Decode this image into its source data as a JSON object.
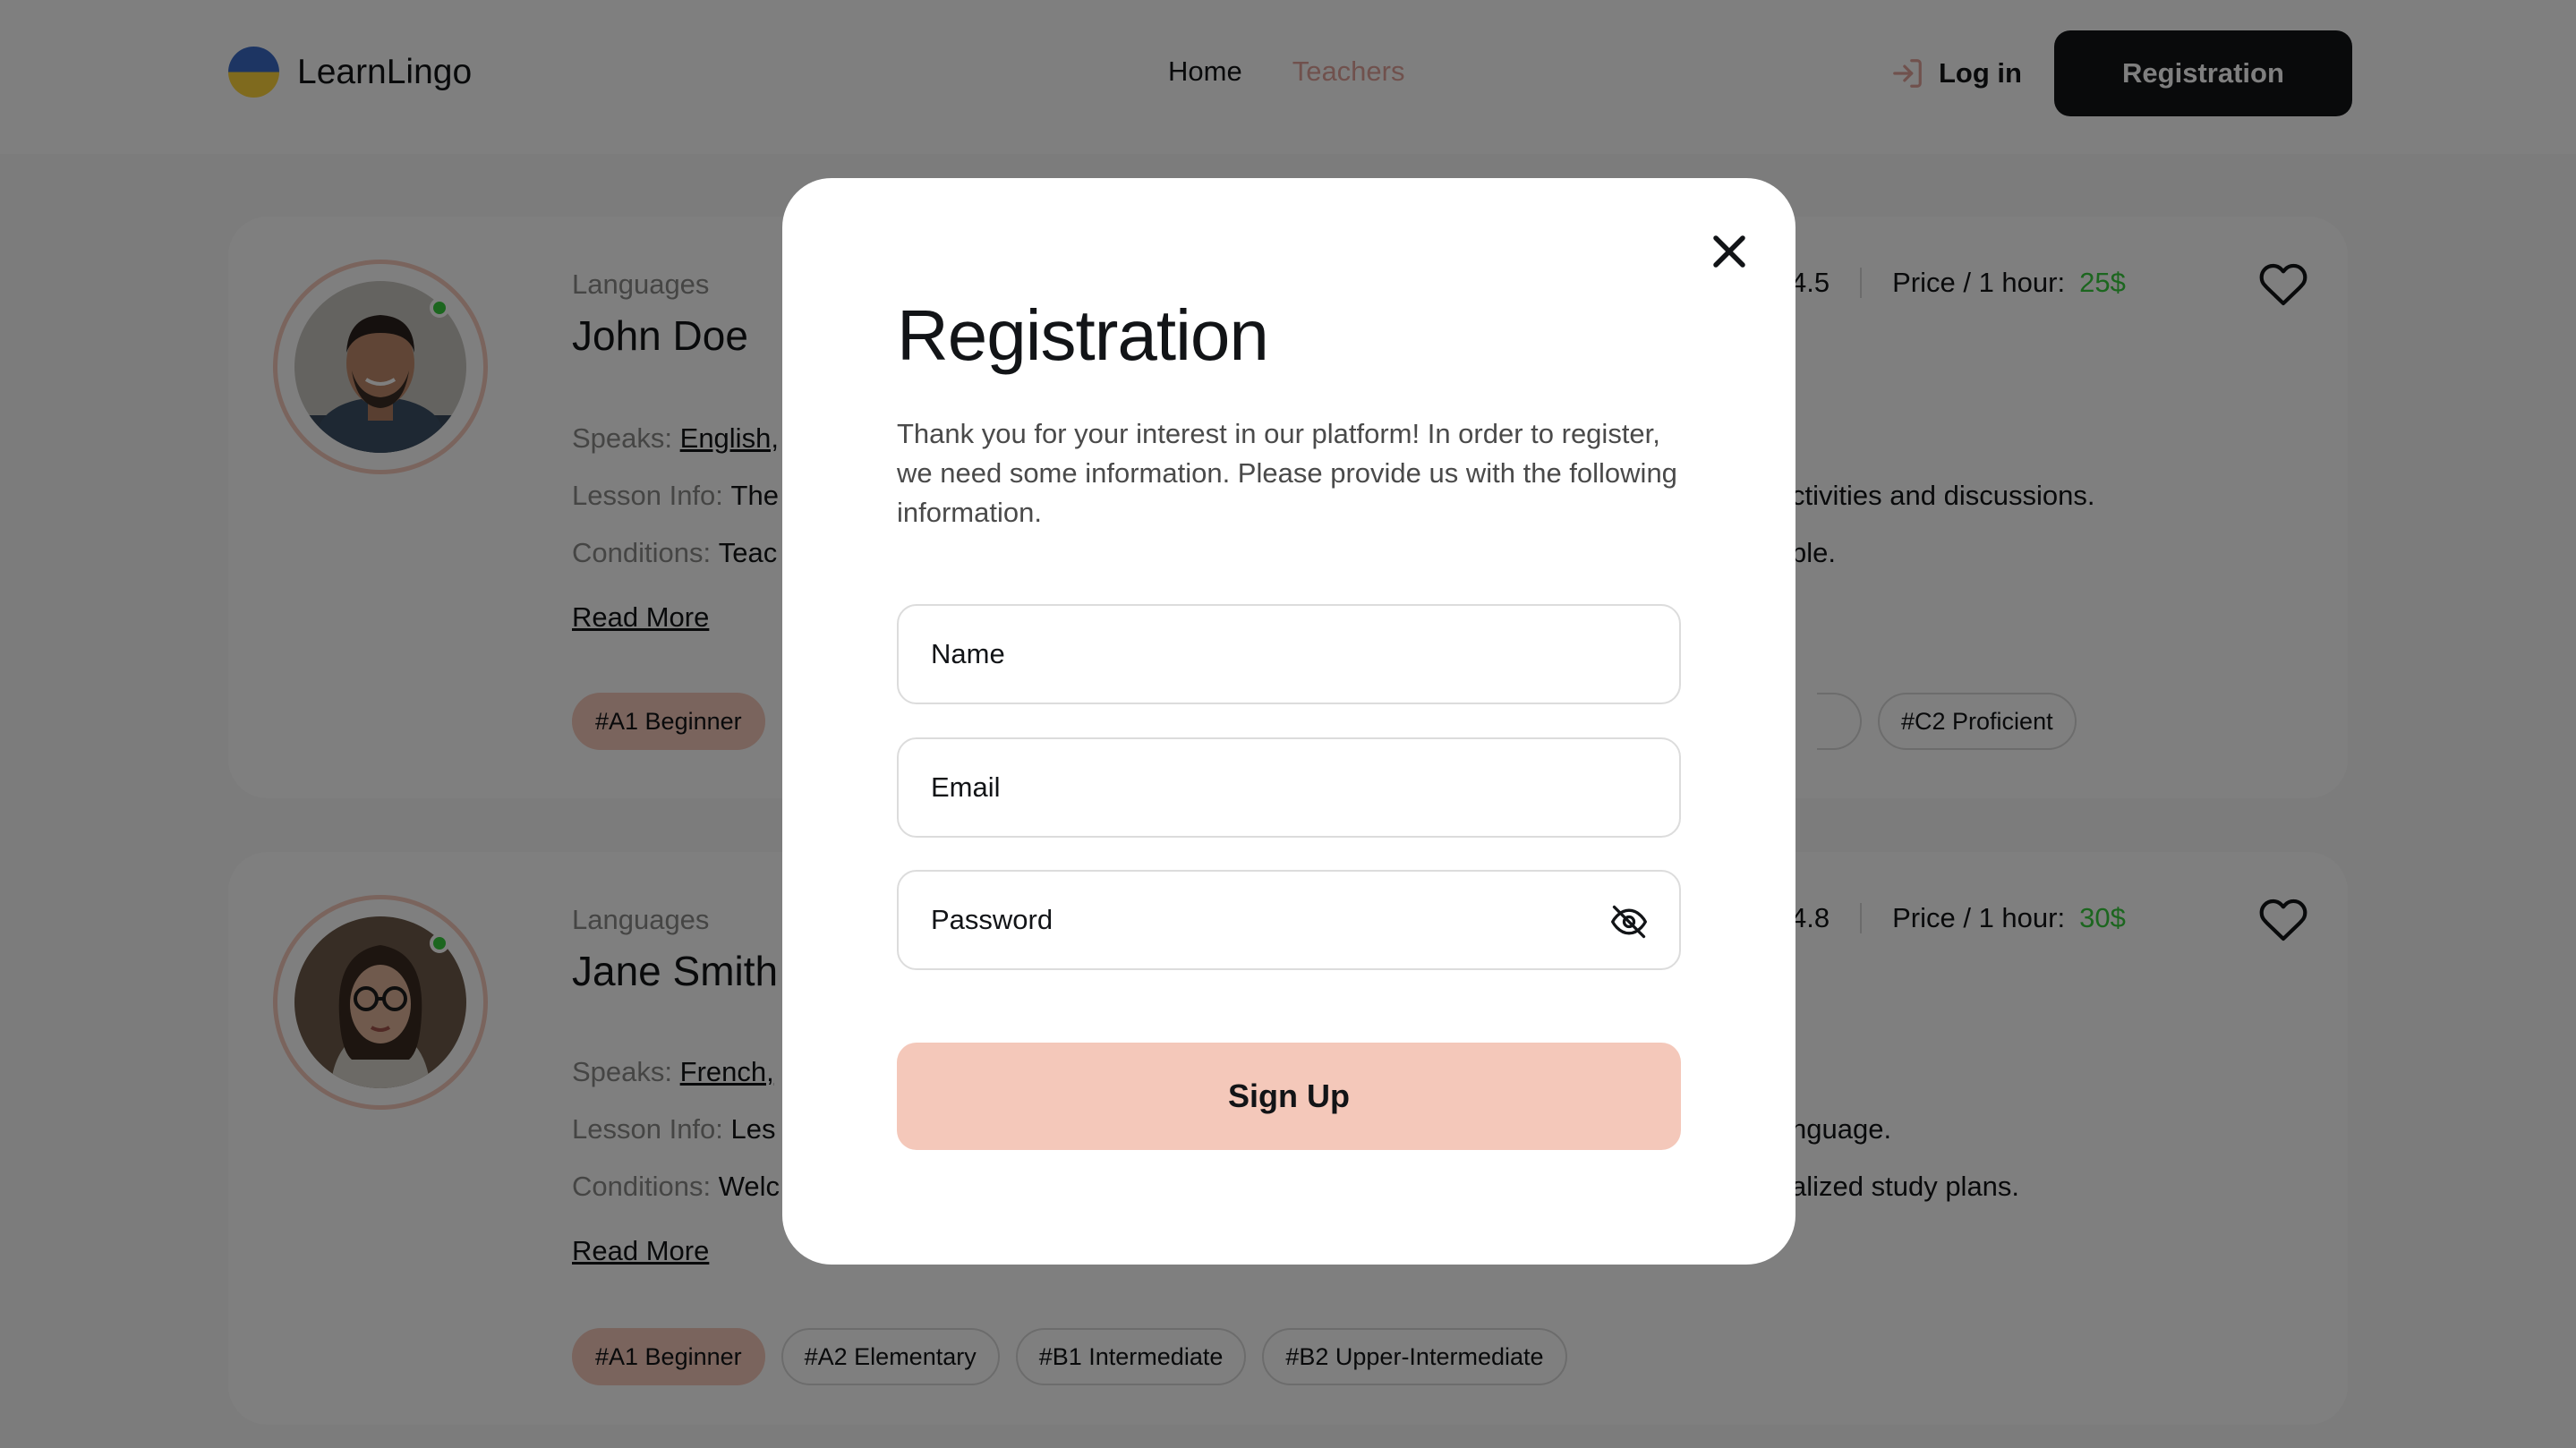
{
  "header": {
    "logo_text": "LearnLingo",
    "nav": [
      {
        "label": "Home",
        "active": false
      },
      {
        "label": "Teachers",
        "active": true
      }
    ],
    "login_label": "Log in",
    "registration_label": "Registration"
  },
  "teachers": [
    {
      "languages_label": "Languages",
      "name": "John Doe",
      "rating": "4.5",
      "price_label": "Price / 1 hour:",
      "price": "25$",
      "speaks_label": "Speaks:",
      "speaks_value": "English,",
      "lesson_label": "Lesson Info:",
      "lesson_value": "The",
      "lesson_tail": "ctivities and discussions.",
      "conditions_label": "Conditions:",
      "conditions_value": "Teac",
      "conditions_tail": "ble.",
      "read_more": "Read More",
      "levels": [
        "#A1 Beginner",
        "#C2 Proficient"
      ]
    },
    {
      "languages_label": "Languages",
      "name": "Jane Smith",
      "rating": "4.8",
      "price_label": "Price / 1 hour:",
      "price": "30$",
      "speaks_label": "Speaks:",
      "speaks_value": "French,",
      "lesson_label": "Lesson Info:",
      "lesson_value": "Les",
      "lesson_tail": "nguage.",
      "conditions_label": "Conditions:",
      "conditions_value": "Welc",
      "conditions_tail": "alized study plans.",
      "read_more": "Read More",
      "levels": [
        "#A1 Beginner",
        "#A2 Elementary",
        "#B1 Intermediate",
        "#B2 Upper-Intermediate"
      ]
    }
  ],
  "modal": {
    "title": "Registration",
    "description": "Thank you for your interest in our platform! In order to register, we need some information. Please provide us with the following information.",
    "name_placeholder": "Name",
    "email_placeholder": "Email",
    "password_placeholder": "Password",
    "submit_label": "Sign Up"
  },
  "colors": {
    "accent": "#f4c8ba",
    "dark": "#121417",
    "price_green": "#38cd3e"
  }
}
